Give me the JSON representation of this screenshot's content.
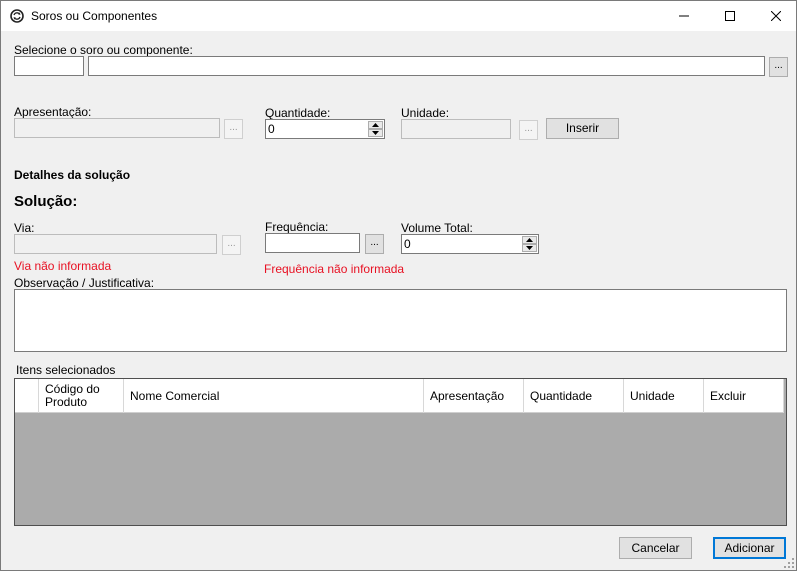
{
  "window": {
    "title": "Soros ou Componentes",
    "icon": "circular-arrows-icon"
  },
  "selector": {
    "label": "Selecione o soro ou componente:",
    "code_value": "",
    "name_value": "",
    "browse_label": "..."
  },
  "apresentacao": {
    "label": "Apresentação:",
    "value": "",
    "browse_label": "..."
  },
  "quantidade": {
    "label": "Quantidade:",
    "value": "0"
  },
  "unidade": {
    "label": "Unidade:",
    "value": "",
    "browse_label": "..."
  },
  "inserir_label": "Inserir",
  "detalhes": {
    "heading": "Detalhes da solução",
    "solucao_label": "Solução:"
  },
  "via": {
    "label": "Via:",
    "value": "",
    "browse_label": "...",
    "error": "Via não informada"
  },
  "frequencia": {
    "label": "Frequência:",
    "value": "",
    "browse_label": "...",
    "error": "Frequência não informada"
  },
  "volume_total": {
    "label": "Volume Total:",
    "value": "0"
  },
  "observacao": {
    "label": "Observação / Justificativa:",
    "value": ""
  },
  "itens": {
    "label": "Itens selecionados",
    "columns": [
      "Código do Produto",
      "Nome Comercial",
      "Apresentação",
      "Quantidade",
      "Unidade",
      "Excluir"
    ],
    "rows": []
  },
  "footer": {
    "cancel_label": "Cancelar",
    "add_label": "Adicionar"
  },
  "colors": {
    "error": "#e81123",
    "default_button_border": "#0078d7",
    "grid_background": "#ababab"
  }
}
